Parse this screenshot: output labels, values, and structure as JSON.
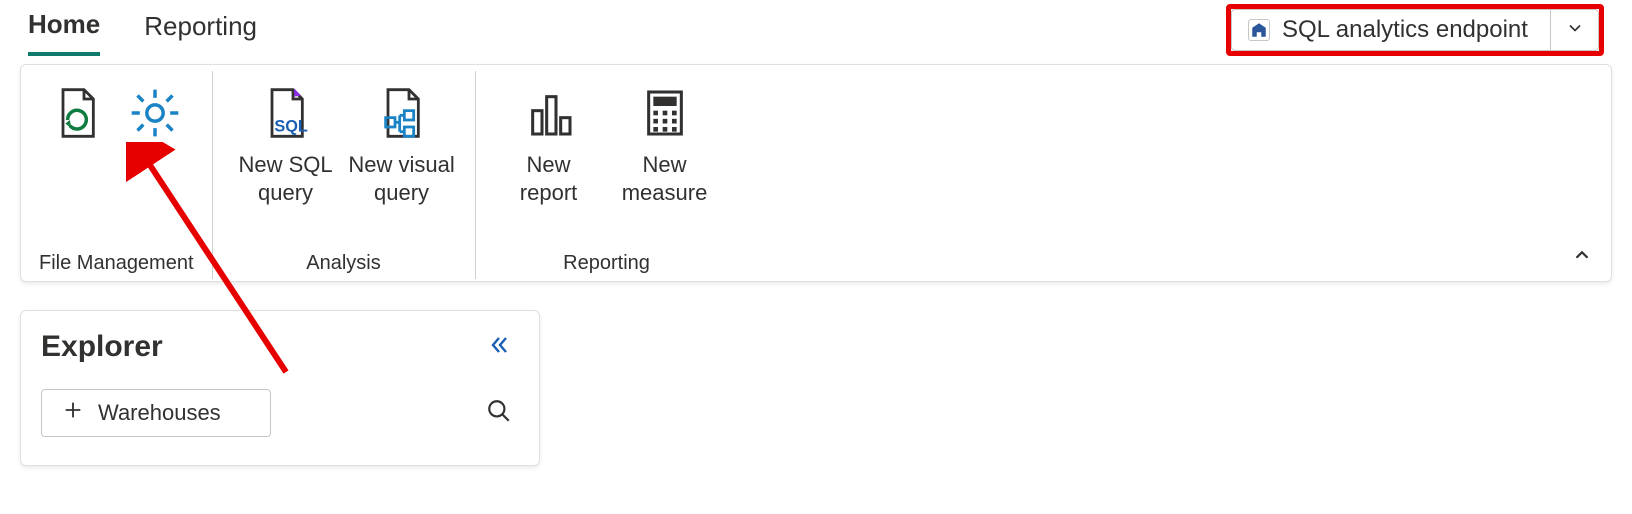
{
  "tabs": {
    "home": "Home",
    "reporting": "Reporting"
  },
  "endpoint": {
    "label": "SQL analytics endpoint"
  },
  "ribbon": {
    "groups": {
      "file_mgmt": {
        "label": "File Management"
      },
      "analysis": {
        "label": "Analysis"
      },
      "reporting": {
        "label": "Reporting"
      }
    },
    "buttons": {
      "new_sql_query": "New SQL\nquery",
      "new_visual_query": "New visual\nquery",
      "new_report": "New\nreport",
      "new_measure": "New\nmeasure"
    }
  },
  "explorer": {
    "title": "Explorer",
    "add_warehouses": "Warehouses"
  }
}
